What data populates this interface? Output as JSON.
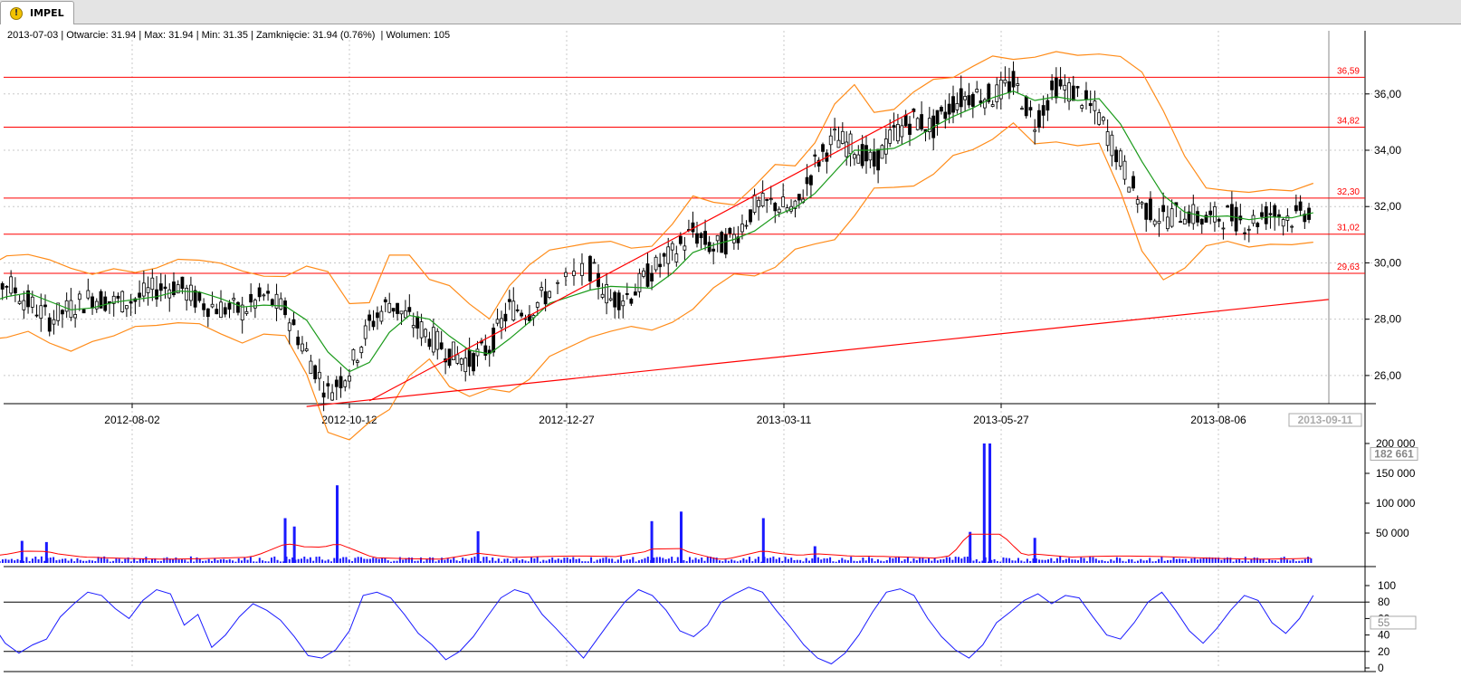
{
  "tab": {
    "icon": "warning-icon",
    "label": "IMPEL"
  },
  "info": {
    "date": "2013-07-03",
    "text": "2013-07-03 | Otwarcie: 31.94 | Max: 31.94 | Min: 31.35 | Zamknięcie: 31.94 (0.76%)  | Wolumen: 105"
  },
  "colors": {
    "resistance": "#ff0000",
    "bollinger": "#ff8c1a",
    "ma": "#1a9a1a",
    "volume": "#1a1aff",
    "volume_ma": "#ff0000",
    "stoch": "#1a1aff",
    "grid": "#c8c8c8"
  },
  "chart_data": [
    {
      "type": "candlestick",
      "title": "IMPEL",
      "x_ticks": [
        "2012-08-02",
        "2012-10-12",
        "2012-12-27",
        "2013-03-11",
        "2013-05-27",
        "2013-08-06"
      ],
      "x_cursor_label": "2013-09-11",
      "y_ticks": [
        "26,00",
        "28,00",
        "30,00",
        "32,00",
        "34,00",
        "36,00"
      ],
      "ylim": [
        25.0,
        37.6
      ],
      "horizontal_levels": [
        {
          "value": 36.59,
          "label": "36,59"
        },
        {
          "value": 34.82,
          "label": "34,82"
        },
        {
          "value": 32.3,
          "label": "32,30"
        },
        {
          "value": 31.02,
          "label": "31,02"
        },
        {
          "value": 29.63,
          "label": "29,63"
        }
      ],
      "close_path": [
        [
          "2012-06-08",
          28.2
        ],
        [
          "2012-06-15",
          28.9
        ],
        [
          "2012-06-22",
          29.3
        ],
        [
          "2012-06-29",
          28.6
        ],
        [
          "2012-07-06",
          28.0
        ],
        [
          "2012-07-13",
          28.4
        ],
        [
          "2012-07-20",
          28.8
        ],
        [
          "2012-07-27",
          28.6
        ],
        [
          "2012-08-03",
          28.7
        ],
        [
          "2012-08-10",
          29.1
        ],
        [
          "2012-08-17",
          29.2
        ],
        [
          "2012-08-24",
          28.6
        ],
        [
          "2012-08-31",
          28.4
        ],
        [
          "2012-09-07",
          28.3
        ],
        [
          "2012-09-14",
          28.8
        ],
        [
          "2012-09-21",
          28.3
        ],
        [
          "2012-09-28",
          26.8
        ],
        [
          "2012-10-05",
          25.4
        ],
        [
          "2012-10-12",
          26.2
        ],
        [
          "2012-10-19",
          27.8
        ],
        [
          "2012-10-26",
          28.6
        ],
        [
          "2012-11-02",
          28.0
        ],
        [
          "2012-11-09",
          27.4
        ],
        [
          "2012-11-16",
          26.8
        ],
        [
          "2012-11-23",
          26.5
        ],
        [
          "2012-11-30",
          27.0
        ],
        [
          "2012-12-07",
          28.4
        ],
        [
          "2012-12-14",
          28.3
        ],
        [
          "2012-12-21",
          29.0
        ],
        [
          "2013-01-04",
          29.8
        ],
        [
          "2013-01-11",
          28.7
        ],
        [
          "2013-01-18",
          28.9
        ],
        [
          "2013-01-25",
          29.7
        ],
        [
          "2013-02-01",
          30.3
        ],
        [
          "2013-02-08",
          31.1
        ],
        [
          "2013-02-15",
          30.5
        ],
        [
          "2013-02-22",
          30.9
        ],
        [
          "2013-03-01",
          32.0
        ],
        [
          "2013-03-08",
          32.1
        ],
        [
          "2013-03-15",
          31.8
        ],
        [
          "2013-03-22",
          33.5
        ],
        [
          "2013-03-29",
          34.4
        ],
        [
          "2013-04-05",
          34.1
        ],
        [
          "2013-04-12",
          33.5
        ],
        [
          "2013-04-19",
          34.6
        ],
        [
          "2013-04-26",
          35.1
        ],
        [
          "2013-05-03",
          34.8
        ],
        [
          "2013-05-10",
          35.7
        ],
        [
          "2013-05-17",
          36.0
        ],
        [
          "2013-05-24",
          35.9
        ],
        [
          "2013-05-31",
          36.4
        ],
        [
          "2013-06-07",
          35.0
        ],
        [
          "2013-06-14",
          36.3
        ],
        [
          "2013-06-21",
          36.0
        ],
        [
          "2013-06-28",
          35.2
        ],
        [
          "2013-07-05",
          33.6
        ],
        [
          "2013-07-12",
          32.0
        ],
        [
          "2013-07-19",
          31.6
        ],
        [
          "2013-07-26",
          31.8
        ],
        [
          "2013-08-02",
          31.5
        ],
        [
          "2013-08-09",
          31.7
        ],
        [
          "2013-08-16",
          31.4
        ],
        [
          "2013-08-23",
          31.8
        ],
        [
          "2013-08-30",
          31.6
        ],
        [
          "2013-09-06",
          31.94
        ]
      ],
      "ma_label": "",
      "bollinger_label": "",
      "trendlines": [
        {
          "from": [
            "2012-10-19",
            25.1
          ],
          "to": [
            "2013-04-26",
            35.4
          ]
        },
        {
          "from": [
            "2012-09-28",
            24.9
          ],
          "to": [
            "2013-09-11",
            28.7
          ]
        }
      ]
    },
    {
      "type": "bar",
      "title": "Wolumen",
      "y_ticks": [
        "50 000",
        "100 000",
        "150 000",
        "200 000"
      ],
      "ylim": [
        0,
        200000
      ],
      "current_value_label": "182 661",
      "spikes": [
        {
          "date": "2012-06-27",
          "value": 37000
        },
        {
          "date": "2012-07-05",
          "value": 35000
        },
        {
          "date": "2012-09-21",
          "value": 75000
        },
        {
          "date": "2012-09-24",
          "value": 61000
        },
        {
          "date": "2012-10-08",
          "value": 130000
        },
        {
          "date": "2012-11-26",
          "value": 53000
        },
        {
          "date": "2013-01-25",
          "value": 70000
        },
        {
          "date": "2013-02-04",
          "value": 86000
        },
        {
          "date": "2013-03-04",
          "value": 75000
        },
        {
          "date": "2013-03-22",
          "value": 28000
        },
        {
          "date": "2013-05-16",
          "value": 52000
        },
        {
          "date": "2013-05-21",
          "value": 205000
        },
        {
          "date": "2013-05-23",
          "value": 205000
        },
        {
          "date": "2013-06-07",
          "value": 42000
        }
      ]
    },
    {
      "type": "line",
      "title": "Stochastic",
      "y_ticks": [
        "0",
        "20",
        "40",
        "60",
        "80",
        "100"
      ],
      "ylim": [
        0,
        100
      ],
      "levels": [
        80,
        20
      ],
      "current_value_label": "55",
      "values": [
        95,
        82,
        55,
        30,
        18,
        28,
        35,
        62,
        78,
        92,
        88,
        72,
        60,
        82,
        95,
        90,
        52,
        65,
        25,
        40,
        62,
        78,
        70,
        58,
        38,
        15,
        12,
        22,
        45,
        88,
        92,
        85,
        65,
        42,
        28,
        10,
        20,
        38,
        62,
        85,
        95,
        90,
        65,
        48,
        30,
        12,
        35,
        58,
        80,
        95,
        88,
        70,
        45,
        38,
        52,
        80,
        90,
        98,
        92,
        70,
        50,
        28,
        12,
        5,
        18,
        40,
        68,
        92,
        96,
        88,
        60,
        38,
        22,
        12,
        28,
        55,
        68,
        82,
        90,
        78,
        88,
        85,
        62,
        40,
        35,
        55,
        80,
        92,
        70,
        45,
        30,
        48,
        70,
        88,
        82,
        55,
        42,
        60,
        88
      ]
    }
  ]
}
